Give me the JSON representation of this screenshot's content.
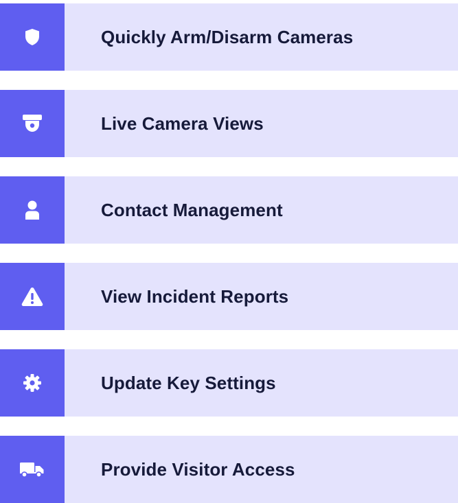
{
  "theme": {
    "icon_bg": "#5f5ef0",
    "label_bg": "#e4e3fd",
    "label_color": "#161a3a",
    "icon_color": "#ffffff"
  },
  "features": [
    {
      "icon": "shield-icon",
      "label": "Quickly Arm/Disarm Cameras"
    },
    {
      "icon": "security-camera-icon",
      "label": "Live Camera Views"
    },
    {
      "icon": "person-icon",
      "label": "Contact Management"
    },
    {
      "icon": "warning-icon",
      "label": "View Incident Reports"
    },
    {
      "icon": "gear-icon",
      "label": "Update Key Settings"
    },
    {
      "icon": "truck-icon",
      "label": "Provide Visitor Access"
    }
  ]
}
